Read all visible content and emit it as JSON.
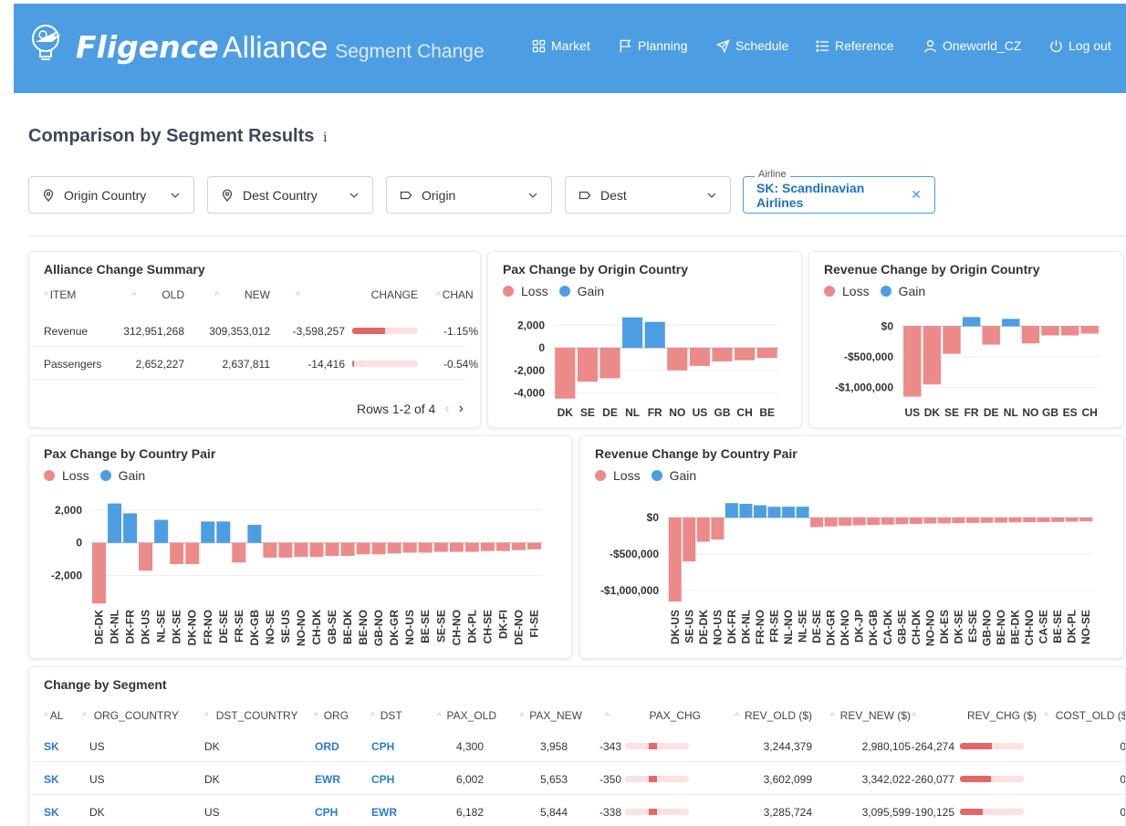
{
  "header": {
    "brand_name": "Fligence",
    "brand_alliance": "Alliance",
    "brand_subtitle": "Segment Change",
    "nav": [
      {
        "label": "Market",
        "icon": "grid-icon"
      },
      {
        "label": "Planning",
        "icon": "flag-icon"
      },
      {
        "label": "Schedule",
        "icon": "send-icon"
      },
      {
        "label": "Reference",
        "icon": "list-icon"
      },
      {
        "label": "Oneworld_CZ",
        "icon": "user-icon"
      },
      {
        "label": "Log out",
        "icon": "power-icon"
      }
    ]
  },
  "page": {
    "title": "Comparison by Segment Results",
    "info_glyph": "i"
  },
  "filters": {
    "origin_country": "Origin Country",
    "dest_country": "Dest Country",
    "origin": "Origin",
    "dest": "Dest",
    "airline_label": "Airline",
    "airline_value": "SK: Scandinavian Airlines"
  },
  "colors": {
    "loss": "#ec8a8a",
    "gain": "#4d9de3",
    "bar_fill": "#e46666",
    "bar_track": "#fbe1e1"
  },
  "legend": {
    "loss": "Loss",
    "gain": "Gain"
  },
  "summary": {
    "title": "Alliance Change Summary",
    "columns": [
      "ITEM",
      "OLD",
      "NEW",
      "CHANGE",
      "CHAN"
    ],
    "rows": [
      {
        "item": "Revenue",
        "old": "312,951,268",
        "new": "309,353,012",
        "change": "-3,598,257",
        "pct": "-1.15%",
        "bar_fraction": 0.5
      },
      {
        "item": "Passengers",
        "old": "2,652,227",
        "new": "2,637,811",
        "change": "-14,416",
        "pct": "-0.54%",
        "bar_fraction": 0.02
      }
    ],
    "pager": "Rows 1-2 of 4"
  },
  "chart_data": [
    {
      "id": "pax-origin",
      "type": "bar",
      "title": "Pax Change by Origin Country",
      "categories": [
        "DK",
        "SE",
        "DE",
        "NL",
        "FR",
        "NO",
        "US",
        "GB",
        "CH",
        "BE"
      ],
      "values": [
        -4500,
        -3000,
        -2700,
        2700,
        2300,
        -2000,
        -1600,
        -1200,
        -1100,
        -900
      ],
      "ylim": [
        -4600,
        3000
      ],
      "yticks": [
        2000,
        0,
        -2000,
        -4000
      ],
      "ytick_labels": [
        "2,000",
        "0",
        "-2,000",
        "-4,000"
      ]
    },
    {
      "id": "rev-origin",
      "type": "bar",
      "title": "Revenue Change by Origin Country",
      "categories": [
        "US",
        "DK",
        "SE",
        "FR",
        "DE",
        "NL",
        "NO",
        "GB",
        "ES",
        "CH"
      ],
      "values": [
        -1150000,
        -950000,
        -450000,
        150000,
        -300000,
        120000,
        -280000,
        -150000,
        -150000,
        -120000
      ],
      "ylim": [
        -1200000,
        200000
      ],
      "yticks": [
        0,
        -500000,
        -1000000
      ],
      "ytick_labels": [
        "$0",
        "-$500,000",
        "-$1,000,000"
      ]
    },
    {
      "id": "pax-pair",
      "type": "bar",
      "title": "Pax Change by Country Pair",
      "categories": [
        "DE-DK",
        "DK-NL",
        "DK-FR",
        "DK-US",
        "NL-SE",
        "DK-SE",
        "DK-NO",
        "FR-NO",
        "DE-SE",
        "FR-SE",
        "DK-GB",
        "NO-SE",
        "SE-US",
        "NO-NO",
        "CH-DK",
        "GB-SE",
        "BE-DK",
        "BE-NO",
        "GB-NO",
        "DK-GR",
        "NO-US",
        "BE-SE",
        "SE-SE",
        "CH-NO",
        "DK-PL",
        "CH-SE",
        "DK-FI",
        "DE-NO",
        "FI-SE"
      ],
      "values": [
        -3700,
        2400,
        1800,
        -1700,
        1400,
        -1300,
        -1300,
        1300,
        1300,
        -1200,
        1100,
        -900,
        -900,
        -850,
        -850,
        -800,
        -800,
        -700,
        -700,
        -650,
        -600,
        -600,
        -550,
        -550,
        -550,
        -500,
        -500,
        -450,
        -400
      ],
      "ylim": [
        -3800,
        2600
      ],
      "yticks": [
        2000,
        0,
        -2000
      ],
      "ytick_labels": [
        "2,000",
        "0",
        "-2,000"
      ]
    },
    {
      "id": "rev-pair",
      "type": "bar",
      "title": "Revenue Change by Country Pair",
      "categories": [
        "DK-US",
        "SE-US",
        "DE-DK",
        "NO-US",
        "DK-FR",
        "DK-NL",
        "FR-NO",
        "FR-SE",
        "NL-NO",
        "NL-SE",
        "DE-SE",
        "DK-GR",
        "DK-NO",
        "DK-JP",
        "DK-GB",
        "CA-DK",
        "GB-SE",
        "CH-DK",
        "NO-NO",
        "DK-ES",
        "DK-SE",
        "ES-SE",
        "GB-NO",
        "BE-NO",
        "BE-DK",
        "CH-NO",
        "CA-SE",
        "BE-SE",
        "DK-PL",
        "NO-SE"
      ],
      "values": [
        -1150000,
        -600000,
        -330000,
        -300000,
        200000,
        190000,
        170000,
        150000,
        150000,
        150000,
        -130000,
        -120000,
        -110000,
        -105000,
        -100000,
        -95000,
        -90000,
        -85000,
        -80000,
        -78000,
        -75000,
        -72000,
        -70000,
        -68000,
        -65000,
        -62000,
        -60000,
        -58000,
        -55000,
        -50000
      ],
      "ylim": [
        -1200000,
        240000
      ],
      "yticks": [
        0,
        -500000,
        -1000000
      ],
      "ytick_labels": [
        "$0",
        "-$500,000",
        "-$1,000,000"
      ]
    }
  ],
  "segment": {
    "title": "Change by Segment",
    "columns": [
      "AL",
      "ORG_COUNTRY",
      "DST_COUNTRY",
      "ORG",
      "DST",
      "PAX_OLD",
      "PAX_NEW",
      "PAX_CHG",
      "REV_OLD ($)",
      "REV_NEW ($)",
      "REV_CHG ($)",
      "COST_OLD ($)"
    ],
    "rows": [
      {
        "al": "SK",
        "org_country": "US",
        "dst_country": "DK",
        "org": "ORD",
        "dst": "CPH",
        "pax_old": "4,300",
        "pax_new": "3,958",
        "pax_chg": "-343",
        "pax_frac": 0.13,
        "rev_old": "3,244,379",
        "rev_new": "2,980,105",
        "rev_chg": "-264,274",
        "rev_frac": 0.5,
        "cost_old": "0"
      },
      {
        "al": "SK",
        "org_country": "US",
        "dst_country": "DK",
        "org": "EWR",
        "dst": "CPH",
        "pax_old": "6,002",
        "pax_new": "5,653",
        "pax_chg": "-350",
        "pax_frac": 0.13,
        "rev_old": "3,602,099",
        "rev_new": "3,342,022",
        "rev_chg": "-260,077",
        "rev_frac": 0.49,
        "cost_old": "0"
      },
      {
        "al": "SK",
        "org_country": "DK",
        "dst_country": "US",
        "org": "CPH",
        "dst": "EWR",
        "pax_old": "6,182",
        "pax_new": "5,844",
        "pax_chg": "-338",
        "pax_frac": 0.13,
        "rev_old": "3,285,724",
        "rev_new": "3,095,599",
        "rev_chg": "-190,125",
        "rev_frac": 0.36,
        "cost_old": "0"
      }
    ]
  }
}
